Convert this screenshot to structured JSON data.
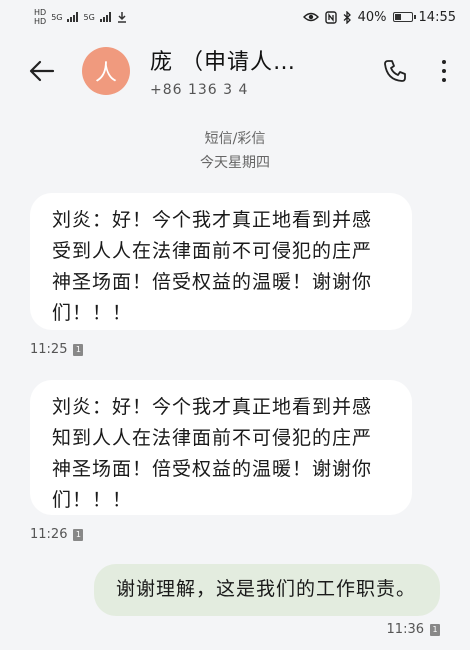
{
  "statusbar": {
    "left_label_top": "HD",
    "left_label_bottom": "HD",
    "signal1": "5G",
    "signal2": "5G",
    "battery_percent": "40%",
    "battery_level": 0.4,
    "time": "14:55"
  },
  "header": {
    "avatar_letter": "人",
    "contact_name": "庞  （申请人…",
    "contact_phone": "+86 136 3    4"
  },
  "thread": {
    "type_label": "短信/彩信",
    "date_label": "今天星期四"
  },
  "messages": [
    {
      "direction": "incoming",
      "lines": [
        "刘炎：好！今个我才真正地看到并感",
        "受到人人在法律面前不可侵犯的庄严",
        "神圣场面！倍受权益的温暖！谢谢你",
        "们！！！"
      ],
      "time": "11:25",
      "sim": "1"
    },
    {
      "direction": "incoming",
      "lines": [
        "刘炎：好！今个我才真正地看到并感",
        "知到人人在法律面前不可侵犯的庄严",
        "神圣场面！倍受权益的温暖！谢谢你",
        "们！！！"
      ],
      "time": "11:26",
      "sim": "1"
    },
    {
      "direction": "outgoing",
      "lines": [
        "谢谢理解，这是我们的工作职责。"
      ],
      "time": "11:36",
      "sim": "1"
    }
  ],
  "icons": {
    "back": "arrow-left-icon",
    "call": "phone-icon",
    "more": "more-vertical-icon",
    "eye": "eye-icon",
    "nfc": "nfc-icon",
    "bluetooth": "bluetooth-icon",
    "download": "download-icon"
  },
  "colors": {
    "avatar": "#f09a7e",
    "incoming_bubble": "#ffffff",
    "outgoing_bubble": "#e3ecdf",
    "background": "#f4f5f7"
  }
}
